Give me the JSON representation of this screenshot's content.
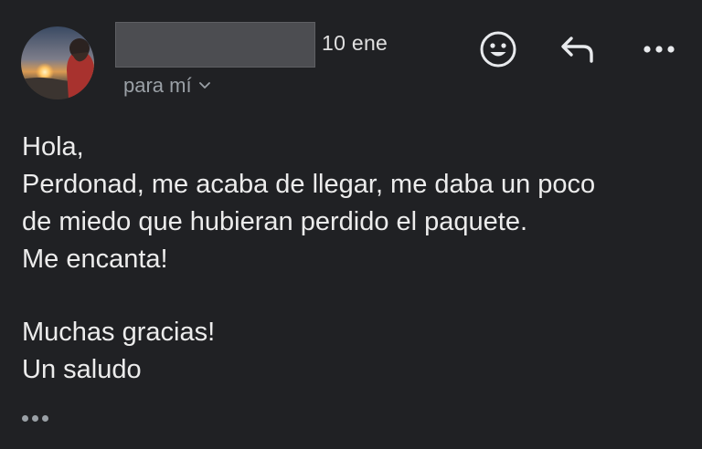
{
  "message": {
    "date": "10 ene",
    "recipient_label": "para mí",
    "body_lines": [
      "Hola,",
      "Perdonad, me acaba de llegar, me daba un poco",
      "de miedo que hubieran perdido el paquete.",
      "Me encanta!",
      "",
      "Muchas gracias!",
      "Un saludo"
    ]
  },
  "icons": {
    "avatar": "avatar-sunset-photo",
    "sender_name": "redacted-sender-name",
    "recipient_toggle": "chevron-down-icon",
    "emoji_reaction": "smiley-face-icon",
    "reply": "reply-arrow-icon",
    "more": "more-horizontal-icon",
    "show_trimmed": "ellipsis-icon"
  },
  "colors": {
    "background": "#202124",
    "text_primary": "#ececec",
    "text_secondary": "#9aa0a6",
    "redaction": "#4c4d51"
  }
}
